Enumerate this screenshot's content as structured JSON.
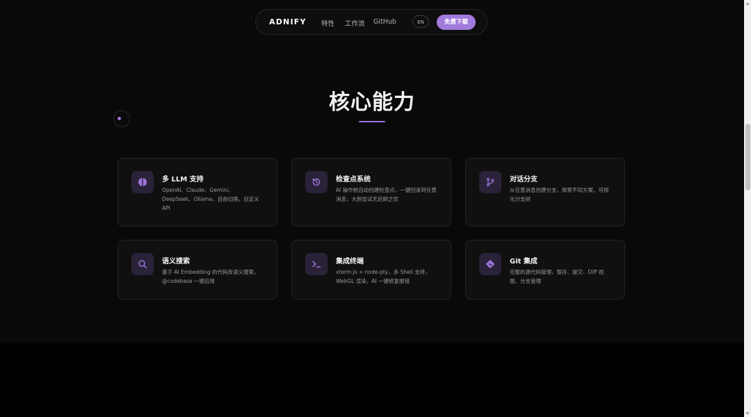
{
  "nav": {
    "brand": "ADNIFY",
    "links": [
      "特性",
      "工作流",
      "GitHub"
    ],
    "lang": "EN",
    "download": "免费下载"
  },
  "section": {
    "title": "核心能力"
  },
  "features": [
    {
      "title": "多 LLM 支持",
      "desc": "OpenAI、Claude、Gemini、DeepSeek、Ollama，自由切换，自定义 API",
      "icon": "brain-icon"
    },
    {
      "title": "检查点系统",
      "desc": "AI 操作前自动创建检查点，一键回滚到任意消息，大胆尝试无后顾之忧",
      "icon": "history-icon"
    },
    {
      "title": "对话分支",
      "desc": "从任意消息创建分支，探索不同方案，可视化分支树",
      "icon": "git-branch-icon"
    },
    {
      "title": "语义搜索",
      "desc": "基于 AI Embedding 的代码库语义搜索，@codebase 一键启用",
      "icon": "search-icon"
    },
    {
      "title": "集成终端",
      "desc": "xterm.js + node-pty，多 Shell 支持，WebGL 渲染，AI 一键修复报错",
      "icon": "terminal-icon"
    },
    {
      "title": "Git 集成",
      "desc": "完整的源代码管理，暂存、提交、Diff 视图、分支管理",
      "icon": "git-icon"
    }
  ],
  "colors": {
    "accent": "#a07bdc",
    "background": "#090909",
    "card": "#101010"
  }
}
